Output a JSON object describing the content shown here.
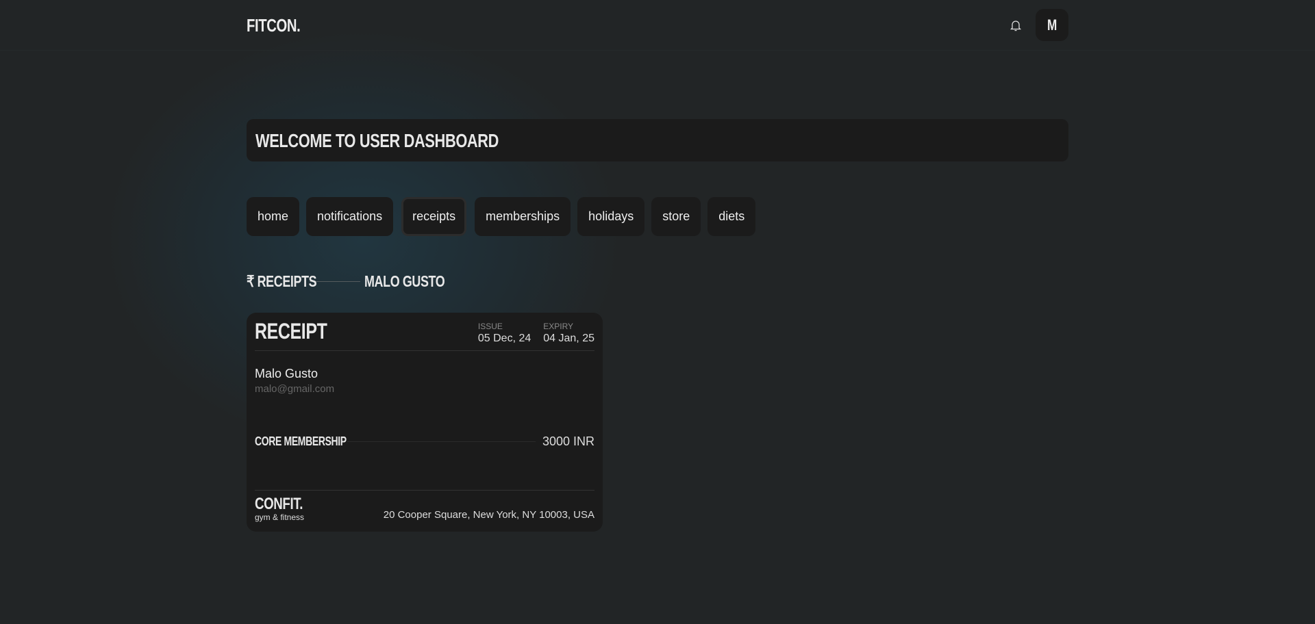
{
  "header": {
    "logo": "FITCON.",
    "avatar_letter": "M"
  },
  "welcome": {
    "title": "WELCOME TO USER DASHBOARD"
  },
  "tabs": [
    {
      "label": "home"
    },
    {
      "label": "notifications"
    },
    {
      "label": "receipts",
      "active": true
    },
    {
      "label": "memberships"
    },
    {
      "label": "holidays"
    },
    {
      "label": "store"
    },
    {
      "label": "diets"
    }
  ],
  "breadcrumb": {
    "section": "₹ RECEIPTS",
    "user": "MALO GUSTO"
  },
  "receipt": {
    "title": "RECEIPT",
    "issue_label": "ISSUE",
    "issue_date": "05 Dec, 24",
    "expiry_label": "EXPIRY",
    "expiry_date": "04 Jan, 25",
    "customer_name": "Malo Gusto",
    "customer_email": "malo@gmail.com",
    "item_name": "CORE MEMBERSHIP",
    "item_price": "3000 INR",
    "brand": "CONFIT.",
    "brand_sub": "gym & fitness",
    "address": "20 Cooper Square, New York, NY 10003, USA"
  }
}
